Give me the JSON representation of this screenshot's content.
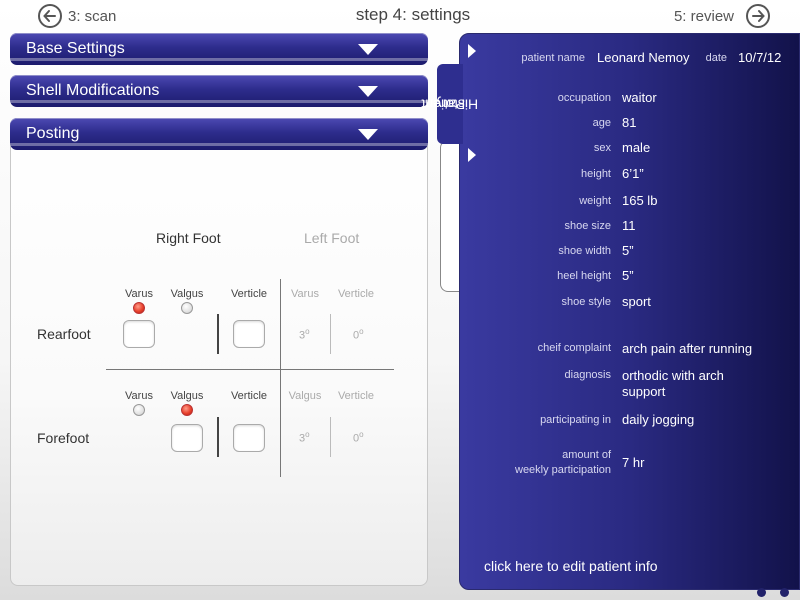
{
  "nav": {
    "back_label": "3: scan",
    "title": "step 4: settings",
    "next_label": "5: review"
  },
  "accordions": [
    {
      "label": "Base Settings"
    },
    {
      "label": "Shell Modifications"
    },
    {
      "label": "Posting"
    }
  ],
  "posting": {
    "right_foot": "Right Foot",
    "left_foot": "Left Foot",
    "rearfoot": {
      "label": "Rearfoot",
      "right": {
        "varus": "Varus",
        "valgus": "Valgus",
        "verticle": "Verticle",
        "selected": "varus"
      },
      "left": {
        "col1": "Varus",
        "col2": "Verticle",
        "val1": "3",
        "val2": "0"
      }
    },
    "forefoot": {
      "label": "Forefoot",
      "right": {
        "varus": "Varus",
        "valgus": "Valgus",
        "verticle": "Verticle",
        "selected": "valgus"
      },
      "left": {
        "col1": "Valgus",
        "col2": "Verticle",
        "val1": "3",
        "val2": "0"
      }
    },
    "degree_symbol": "o"
  },
  "patient": {
    "tab_label_line1": "Patient",
    "tab_label_line2": "History",
    "name_label": "patient name",
    "name": "Leonard Nemoy",
    "date_label": "date",
    "date": "10/7/12",
    "fields": [
      {
        "label": "occupation",
        "value": "waitor"
      },
      {
        "label": "age",
        "value": "81"
      },
      {
        "label": "sex",
        "value": "male"
      },
      {
        "label": "height",
        "value": "6’1”"
      },
      {
        "label": "weight",
        "value": "165 lb"
      },
      {
        "label": "shoe size",
        "value": "11"
      },
      {
        "label": "shoe width",
        "value": "5”"
      },
      {
        "label": "heel height",
        "value": "5”"
      },
      {
        "label": "shoe style",
        "value": "sport"
      }
    ],
    "complaint_label": "cheif complaint",
    "complaint": "arch pain after running",
    "diagnosis_label": "diagnosis",
    "diagnosis_line1": "orthodic with arch",
    "diagnosis_line2": "support",
    "participating_label": "participating in",
    "participating": "daily jogging",
    "amount_label_line1": "amount of",
    "amount_label_line2": "weekly participation",
    "amount": "7 hr",
    "edit_link": "click here to edit patient info"
  },
  "colors": {
    "accent": "#2d2c8c",
    "panel_dark": "#12124a",
    "radio_on": "#e8412d"
  },
  "icons": {
    "back": "arrow-left-circle-icon",
    "next": "arrow-right-circle-icon",
    "expand": "triangle-down-icon",
    "tab_arrow": "triangle-right-icon"
  }
}
